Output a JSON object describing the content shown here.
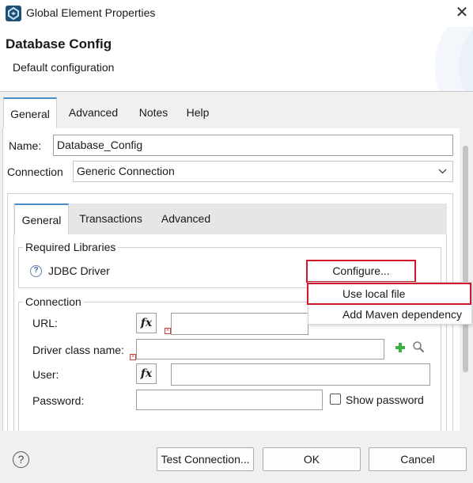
{
  "window": {
    "title": "Global Element Properties",
    "close_glyph": "✕"
  },
  "header": {
    "title": "Database Config",
    "subtitle": "Default configuration"
  },
  "tabs": [
    "General",
    "Advanced",
    "Notes",
    "Help"
  ],
  "form": {
    "name_label": "Name:",
    "name_value": "Database_Config",
    "connection_label": "Connection",
    "connection_value": "Generic Connection"
  },
  "inner_tabs": [
    "General",
    "Transactions",
    "Advanced"
  ],
  "required_libraries": {
    "title": "Required Libraries",
    "driver_label": "JDBC Driver",
    "configure_label": "Configure..."
  },
  "configure_menu": [
    "Use local file",
    "Add Maven dependency"
  ],
  "connection_group": {
    "title": "Connection",
    "url_label": "URL:",
    "url_value": "",
    "driver_class_label": "Driver class name:",
    "driver_class_value": "",
    "user_label": "User:",
    "user_value": "",
    "password_label": "Password:",
    "password_value": "",
    "show_password_label": "Show password",
    "fx_label": "fx"
  },
  "footer": {
    "help_glyph": "?",
    "test_connection": "Test Connection...",
    "ok": "OK",
    "cancel": "Cancel"
  },
  "colors": {
    "highlight": "#d0182a",
    "tab_accent": "#4a8cc7",
    "plus": "#3cb043"
  }
}
